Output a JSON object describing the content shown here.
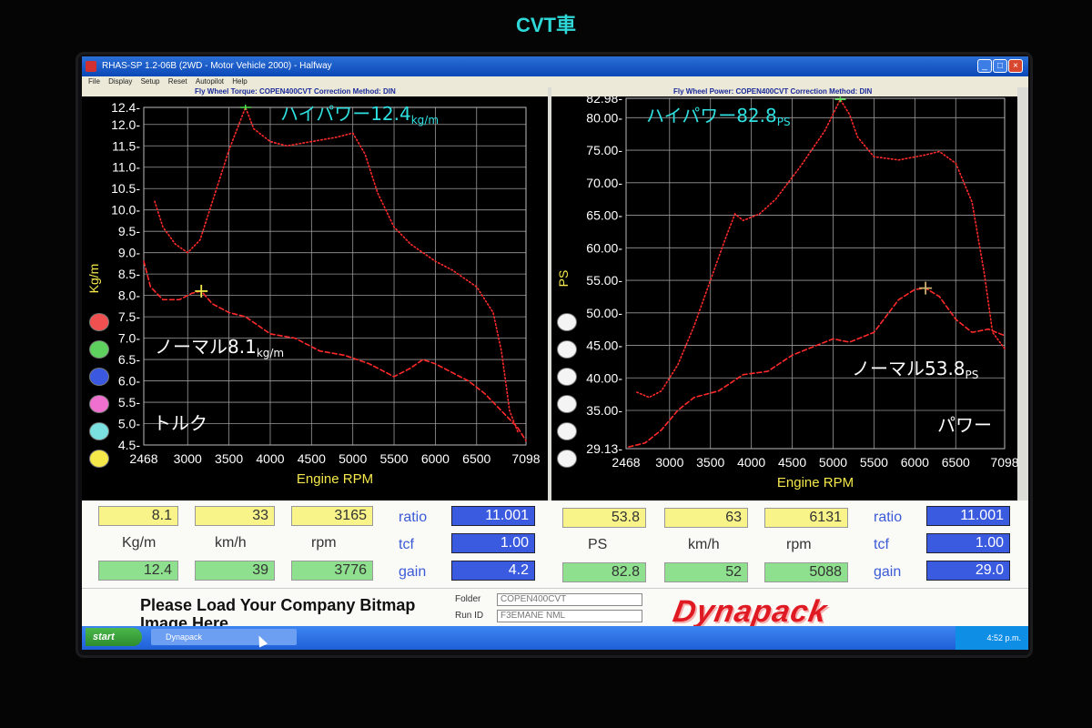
{
  "caption": "CVT車",
  "window": {
    "title": "RHAS-SP 1.2-06B  (2WD - Motor Vehicle 2000) - Halfway",
    "menu": [
      "File",
      "Display",
      "Setup",
      "Reset",
      "Autopilot",
      "Help"
    ]
  },
  "left_panel": {
    "header": "Fly Wheel Torque: COPEN400CVT      Correction Method: DIN",
    "annotation_high": "ハイパワー12.4",
    "annotation_high_unit": "kg/m",
    "annotation_normal": "ノーマル8.1",
    "annotation_normal_unit": "kg/m",
    "annotation_label": "トルク"
  },
  "right_panel": {
    "header": "Fly Wheel Power: COPEN400CVT      Correction Method: DIN",
    "annotation_high": "ハイパワー82.8",
    "annotation_high_unit": "PS",
    "annotation_normal": "ノーマル53.8",
    "annotation_normal_unit": "PS",
    "annotation_label": "パワー"
  },
  "legend_dot_colors": [
    "#f05050",
    "#5ed05e",
    "#3a58e0",
    "#f070d0",
    "#7ae0e0",
    "#f4e84a"
  ],
  "chart_data": [
    {
      "type": "line",
      "xlabel": "Engine RPM",
      "ylabel": "Kg/m",
      "xlim": [
        2468,
        7098
      ],
      "ylim": [
        4.5,
        12.4
      ],
      "x_ticks": [
        "2468",
        "3000",
        "3500",
        "4000",
        "4500",
        "5000",
        "5500",
        "6000",
        "6500",
        "7098"
      ],
      "y_ticks": [
        "4.5",
        "5.0",
        "5.5",
        "6.0",
        "6.5",
        "7.0",
        "7.5",
        "8.0",
        "8.5",
        "9.0",
        "9.5",
        "10.0",
        "10.5",
        "11.0",
        "11.5",
        "12.0",
        "12.4"
      ],
      "grid": true,
      "series": [
        {
          "style": "dotted",
          "color": "#ff2a2a",
          "x": [
            2600,
            2700,
            2850,
            3000,
            3150,
            3300,
            3500,
            3700,
            3800,
            4000,
            4200,
            4500,
            4800,
            5000,
            5150,
            5300,
            5500,
            5700,
            6000,
            6200,
            6500,
            6700,
            6800,
            6900,
            7000
          ],
          "y": [
            10.2,
            9.6,
            9.2,
            9.0,
            9.3,
            10.2,
            11.4,
            12.4,
            11.9,
            11.6,
            11.5,
            11.6,
            11.7,
            11.8,
            11.3,
            10.4,
            9.6,
            9.2,
            8.8,
            8.6,
            8.2,
            7.6,
            6.7,
            5.3,
            4.8
          ]
        },
        {
          "style": "dashed",
          "color": "#ff2a2a",
          "x": [
            2468,
            2550,
            2700,
            2900,
            3050,
            3165,
            3300,
            3500,
            3700,
            4000,
            4300,
            4600,
            4900,
            5200,
            5500,
            5700,
            5850,
            6000,
            6200,
            6400,
            6600,
            6800,
            7000,
            7098
          ],
          "y": [
            8.8,
            8.2,
            7.9,
            7.9,
            8.05,
            8.1,
            7.8,
            7.6,
            7.5,
            7.1,
            7.0,
            6.7,
            6.6,
            6.4,
            6.1,
            6.3,
            6.5,
            6.4,
            6.2,
            6.0,
            5.7,
            5.3,
            4.9,
            4.6
          ]
        }
      ]
    },
    {
      "type": "line",
      "xlabel": "Engine RPM",
      "ylabel": "PS",
      "xlim": [
        2468,
        7098
      ],
      "ylim": [
        29.13,
        82.98
      ],
      "x_ticks": [
        "2468",
        "3000",
        "3500",
        "4000",
        "4500",
        "5000",
        "5500",
        "6000",
        "6500",
        "7098"
      ],
      "y_ticks": [
        "29.13",
        "35.00",
        "40.00",
        "45.00",
        "50.00",
        "55.00",
        "60.00",
        "65.00",
        "70.00",
        "75.00",
        "80.00",
        "82.98"
      ],
      "grid": true,
      "series": [
        {
          "style": "dotted",
          "color": "#ff2a2a",
          "x": [
            2600,
            2750,
            2900,
            3100,
            3300,
            3500,
            3700,
            3800,
            3900,
            4100,
            4300,
            4600,
            4900,
            5088,
            5200,
            5300,
            5500,
            5800,
            6100,
            6300,
            6500,
            6700,
            6850,
            6950,
            7098
          ],
          "y": [
            37.8,
            37.0,
            38.0,
            42.0,
            48.0,
            55.0,
            62.0,
            65.2,
            64.2,
            65.2,
            67.5,
            72.5,
            78.0,
            82.8,
            80.5,
            77.0,
            74.0,
            73.5,
            74.2,
            74.8,
            73.0,
            67.0,
            56.0,
            47.0,
            44.5
          ]
        },
        {
          "style": "dashed",
          "color": "#ff2a2a",
          "x": [
            2500,
            2700,
            2900,
            3100,
            3300,
            3600,
            3900,
            4200,
            4500,
            4800,
            5000,
            5200,
            5500,
            5800,
            6000,
            6131,
            6300,
            6500,
            6700,
            6900,
            7098
          ],
          "y": [
            29.4,
            30.0,
            32.0,
            35.0,
            37.0,
            38.0,
            40.5,
            41.0,
            43.5,
            45.0,
            46.0,
            45.5,
            47.0,
            52.0,
            53.6,
            53.8,
            52.5,
            49.0,
            47.0,
            47.5,
            46.5
          ]
        }
      ]
    }
  ],
  "readouts_left": {
    "row1": [
      "8.1",
      "33",
      "3165"
    ],
    "units": [
      "Kg/m",
      "km/h",
      "rpm"
    ],
    "row2": [
      "12.4",
      "39",
      "3776"
    ],
    "side_labels": [
      "ratio",
      "tcf",
      "gain"
    ],
    "side_values": [
      "11.001",
      "1.00",
      "4.2"
    ]
  },
  "readouts_right": {
    "row1": [
      "53.8",
      "63",
      "6131"
    ],
    "units": [
      "PS",
      "km/h",
      "rpm"
    ],
    "row2": [
      "82.8",
      "52",
      "5088"
    ],
    "side_labels": [
      "ratio",
      "tcf",
      "gain"
    ],
    "side_values": [
      "11.001",
      "1.00",
      "29.0"
    ]
  },
  "footer": {
    "bitmap_text": "Please Load Your Company Bitmap Image Here",
    "folder_label": "Folder",
    "folder_value": "COPEN400CVT",
    "runid_label": "Run ID",
    "runid_value": "F3EMANE NML",
    "logo": "Dynapack"
  },
  "taskbar": {
    "start_label": "start",
    "task_label": "Dynapack",
    "clock": "4:52 p.m."
  }
}
